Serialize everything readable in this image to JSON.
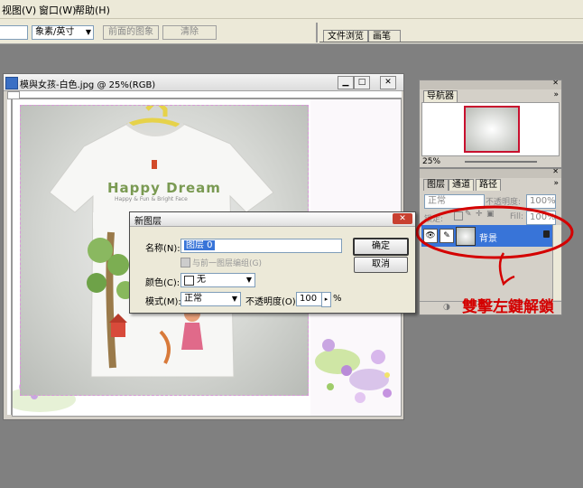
{
  "menu": {
    "view": "视图(V)",
    "window": "窗口(W)",
    "help": "帮助(H)"
  },
  "options": {
    "units": "象素/英寸",
    "front_image": "前面的图象",
    "clear": "清除"
  },
  "workspace_tabs": {
    "file_browser": "文件浏览",
    "brushes": "画笔"
  },
  "document": {
    "title": "模與女孩-白色.jpg @ 25%(RGB)"
  },
  "shirt": {
    "line1": "Happy Dream",
    "line2": "Happy & Fun & Bright Face"
  },
  "navigator": {
    "tab": "导航器",
    "zoom": "25%"
  },
  "layers_panel": {
    "tabs": [
      "图层",
      "通道",
      "路径"
    ],
    "blend_mode": "正常",
    "opacity_label": "不透明度:",
    "opacity_value": "100%",
    "lock_label": "锁定:",
    "fill_label": "Fill:",
    "fill_value": "100%",
    "layer_name": "背景"
  },
  "annotation": {
    "text": "雙擊左鍵解鎖"
  },
  "dialog": {
    "title": "新图层",
    "name_label": "名称(N):",
    "name_value": "图层 0",
    "group_label": "与前一图层编组(G)",
    "color_label": "颜色(C):",
    "color_value": "无",
    "mode_label": "模式(M):",
    "mode_value": "正常",
    "opacity_label": "不透明度(O):",
    "opacity_value": "100",
    "percent": "%",
    "ok": "确定",
    "cancel": "取消"
  },
  "colors": {
    "selection_blue": "#3874d8",
    "annotation_red": "#d40000",
    "dialog_bg": "#ece9d8"
  }
}
